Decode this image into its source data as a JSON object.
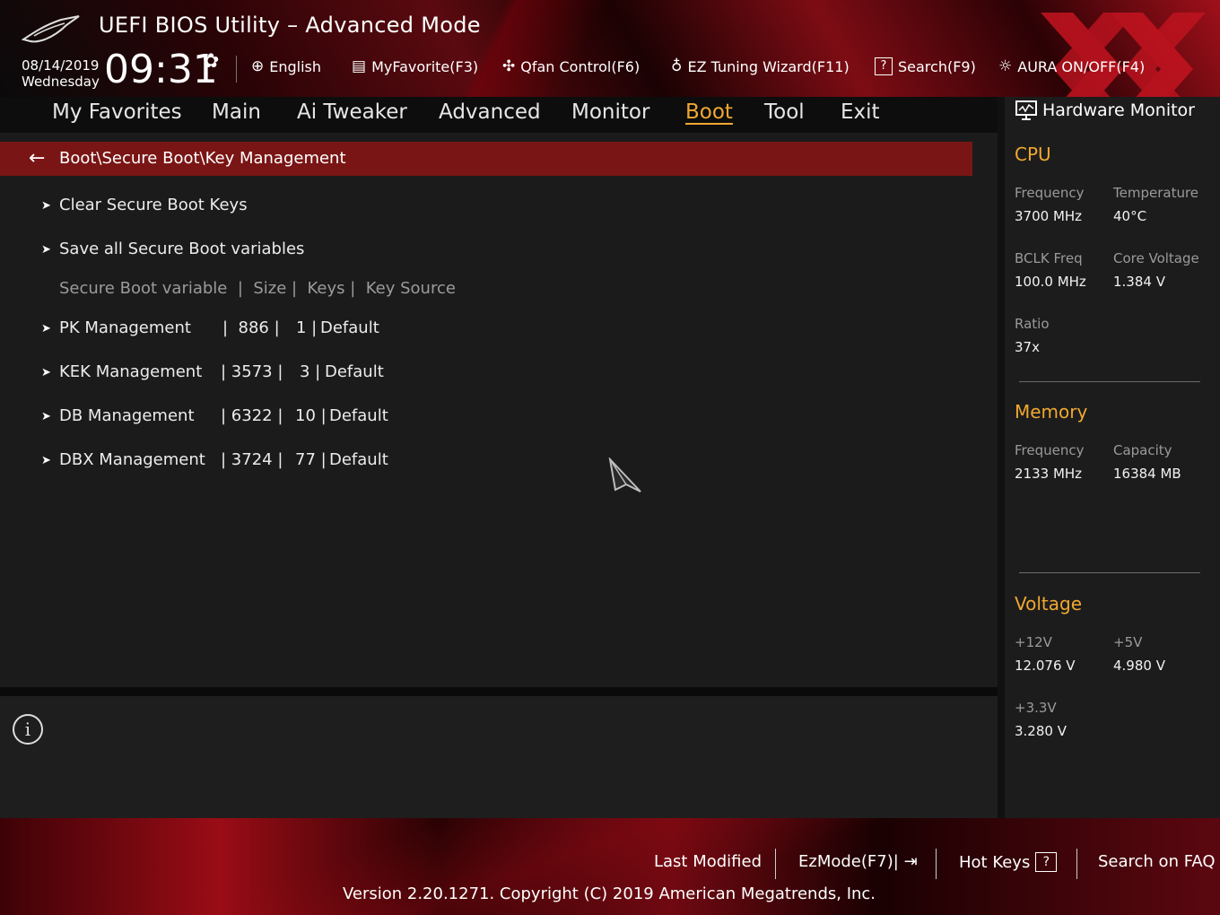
{
  "header": {
    "title": "UEFI BIOS Utility – Advanced Mode",
    "date": "08/14/2019",
    "weekday": "Wednesday",
    "time": "09:31",
    "toolbar": [
      {
        "label": "English",
        "icon": "globe-icon"
      },
      {
        "label": "MyFavorite(F3)",
        "icon": "favorite-list-icon"
      },
      {
        "label": "Qfan Control(F6)",
        "icon": "fan-icon"
      },
      {
        "label": "EZ Tuning Wizard(F11)",
        "icon": "bulb-icon"
      },
      {
        "label": "Search(F9)",
        "icon": "question-box-icon"
      },
      {
        "label": "AURA ON/OFF(F4)",
        "icon": "aura-light-icon"
      }
    ]
  },
  "menu": {
    "tabs": [
      "My Favorites",
      "Main",
      "Ai Tweaker",
      "Advanced",
      "Monitor",
      "Boot",
      "Tool",
      "Exit"
    ],
    "active": "Boot"
  },
  "content": {
    "breadcrumb": "Boot\\Secure Boot\\Key Management",
    "actions": [
      "Clear Secure Boot Keys",
      "Save all Secure Boot variables"
    ],
    "table_header": "Secure Boot variable  |  Size |  Keys |  Key Source",
    "rows": [
      {
        "name": "PK Management",
        "size": "|  886 |",
        "keys": "1 |",
        "source": "Default"
      },
      {
        "name": "KEK Management",
        "size": "| 3573 |",
        "keys": "3 |",
        "source": "Default"
      },
      {
        "name": "DB Management",
        "size": "| 6322 |",
        "keys": "10 |",
        "source": "Default"
      },
      {
        "name": "DBX Management",
        "size": "| 3724 |",
        "keys": "77 |",
        "source": "Default"
      }
    ]
  },
  "hardware_monitor": {
    "title": "Hardware Monitor",
    "cpu": {
      "heading": "CPU",
      "frequency_label": "Frequency",
      "frequency": "3700 MHz",
      "temperature_label": "Temperature",
      "temperature": "40°C",
      "bclk_label": "BCLK Freq",
      "bclk": "100.0 MHz",
      "core_voltage_label": "Core Voltage",
      "core_voltage": "1.384 V",
      "ratio_label": "Ratio",
      "ratio": "37x"
    },
    "memory": {
      "heading": "Memory",
      "frequency_label": "Frequency",
      "frequency": "2133 MHz",
      "capacity_label": "Capacity",
      "capacity": "16384 MB"
    },
    "voltage": {
      "heading": "Voltage",
      "v12_label": "+12V",
      "v12": "12.076 V",
      "v5_label": "+5V",
      "v5": "4.980 V",
      "v33_label": "+3.3V",
      "v33": "3.280 V"
    }
  },
  "footer": {
    "last_modified": "Last Modified",
    "ezmode": "EzMode(F7)|",
    "hot_keys": "Hot Keys",
    "search_faq": "Search on FAQ",
    "version": "Version 2.20.1271. Copyright (C) 2019 American Megatrends, Inc."
  },
  "colors": {
    "accent": "#f0a830",
    "breadcrumb_bg": "#7a1515"
  }
}
